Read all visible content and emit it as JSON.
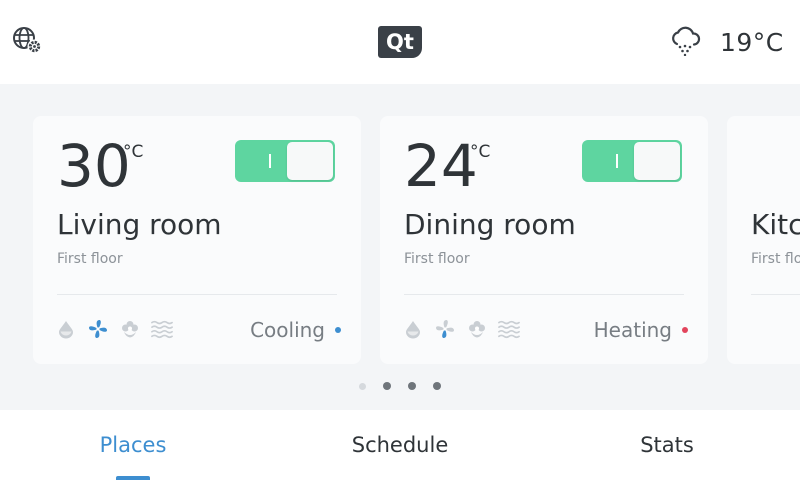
{
  "header": {
    "settings_icon": "globe-gear-icon",
    "logo_text": "Qt",
    "weather_icon": "cloud-snow-icon",
    "weather_temp": "19°C"
  },
  "cards": [
    {
      "temperature": "30",
      "unit": "°C",
      "power_on": true,
      "room": "Living room",
      "floor": "First floor",
      "mode": "Cooling",
      "mode_color": "#3d8ed0",
      "active_icon": "fan-icon"
    },
    {
      "temperature": "24",
      "unit": "°C",
      "power_on": true,
      "room": "Dining room",
      "floor": "First floor",
      "mode": "Heating",
      "mode_color": "#e2445c",
      "active_icon": "fan-icon"
    },
    {
      "room": "Kitchen",
      "floor": "First floor"
    }
  ],
  "feature_icons": [
    "humidity-drop-icon",
    "fan-icon",
    "flower-icon",
    "heat-waves-icon"
  ],
  "pagination": {
    "count": 4,
    "active_index": 0
  },
  "tabs": [
    {
      "label": "Places",
      "active": true
    },
    {
      "label": "Schedule",
      "active": false
    },
    {
      "label": "Stats",
      "active": false
    }
  ],
  "colors": {
    "accent": "#3d8ed0",
    "toggle_on": "#5ed5a0",
    "icon_inactive": "#c9ced3",
    "icon_active": "#3d8ed0"
  }
}
